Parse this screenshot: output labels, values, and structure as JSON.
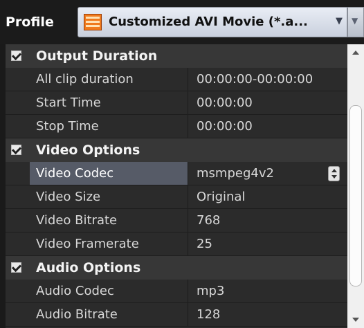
{
  "profile": {
    "label": "Profile",
    "selected": "Customized AVI Movie (*.a...",
    "icon": "film-icon"
  },
  "sections": [
    {
      "title": "Output Duration",
      "rows": [
        {
          "name": "All clip duration",
          "value": "00:00:00-00:00:00"
        },
        {
          "name": "Start Time",
          "value": "00:00:00"
        },
        {
          "name": "Stop Time",
          "value": "00:00:00"
        }
      ]
    },
    {
      "title": "Video Options",
      "rows": [
        {
          "name": "Video Codec",
          "value": "msmpeg4v2"
        },
        {
          "name": "Video Size",
          "value": "Original"
        },
        {
          "name": "Video Bitrate",
          "value": "768"
        },
        {
          "name": "Video Framerate",
          "value": "25"
        }
      ]
    },
    {
      "title": "Audio Options",
      "rows": [
        {
          "name": "Audio Codec",
          "value": "mp3"
        },
        {
          "name": "Audio Bitrate",
          "value": "128"
        }
      ]
    }
  ],
  "colors": {
    "background": "#2b2b2b",
    "section_header": "#373737",
    "selected_row": "#565b67",
    "text": "#d8d8d8"
  }
}
